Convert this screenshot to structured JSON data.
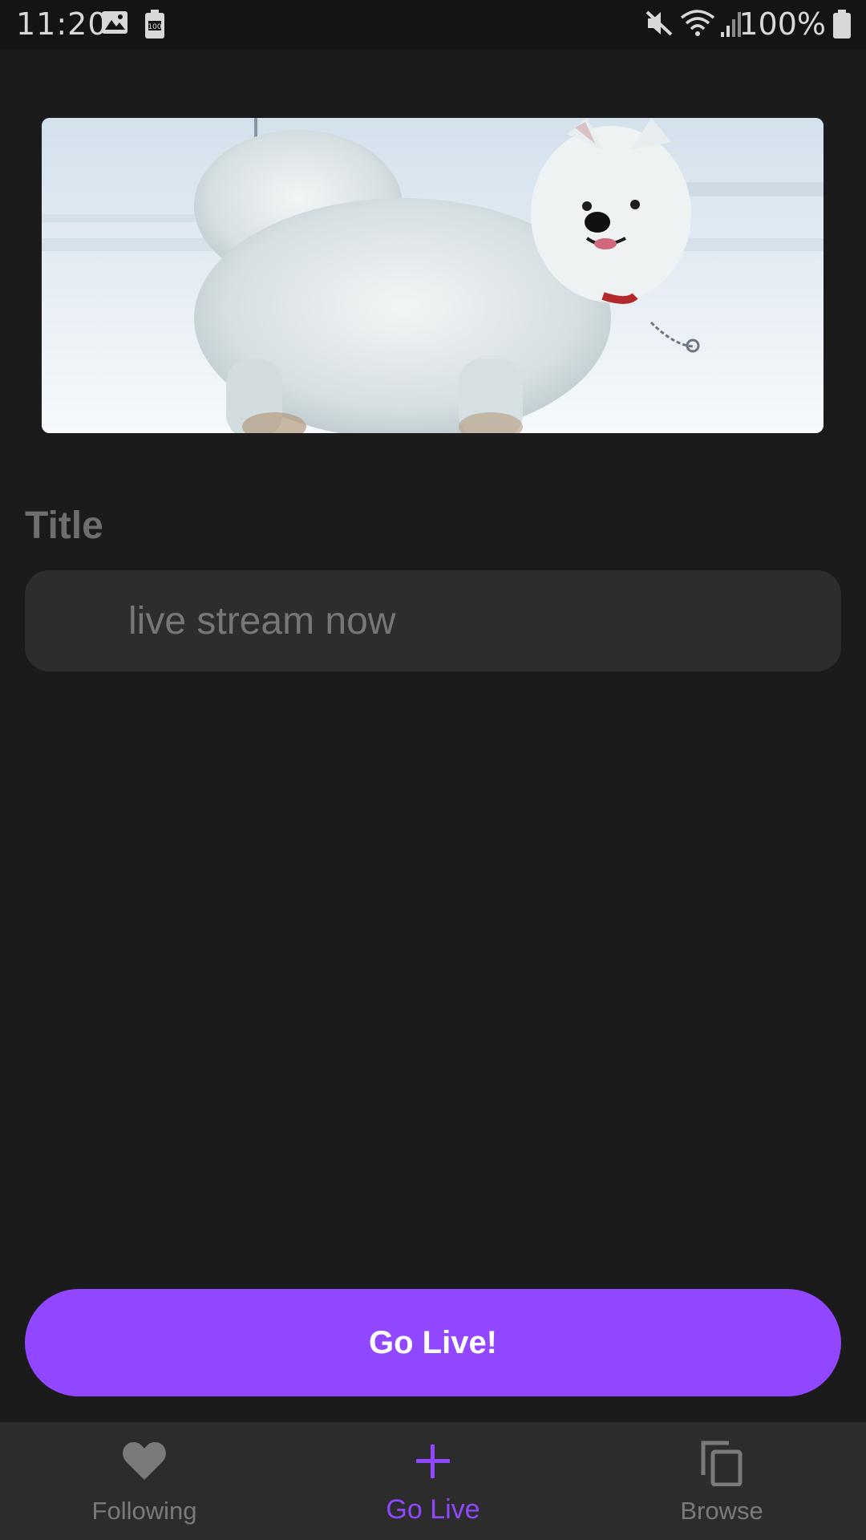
{
  "status_bar": {
    "time": "11:20",
    "battery": "100%",
    "icons": [
      "image-icon",
      "battery-saver-icon",
      "mute-icon",
      "wifi-icon",
      "signal-icon",
      "battery-icon"
    ]
  },
  "thumbnail": {
    "icon": "stream-thumbnail-dog"
  },
  "form": {
    "title_label": "Title",
    "title_value": "live stream now"
  },
  "actions": {
    "go_live_label": "Go Live!"
  },
  "bottom_nav": {
    "items": [
      {
        "label": "Following",
        "icon": "heart-icon"
      },
      {
        "label": "Go Live",
        "icon": "plus-icon",
        "active": true
      },
      {
        "label": "Browse",
        "icon": "copy-icon"
      }
    ]
  },
  "colors": {
    "accent": "#9147ff",
    "background": "#1b1b1b",
    "surface": "#2c2c2c"
  }
}
